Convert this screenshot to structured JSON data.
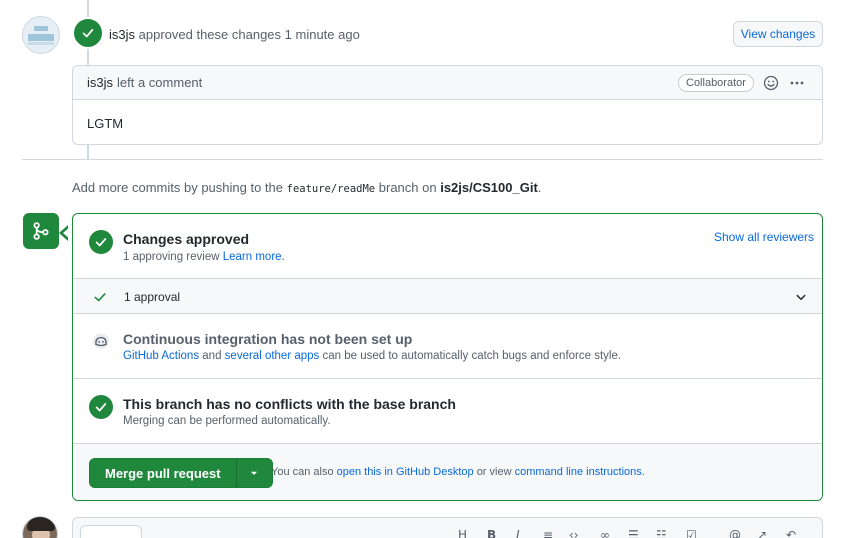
{
  "review": {
    "author": "is3js",
    "action": "approved these changes",
    "time": "1 minute ago",
    "view_changes_label": "View changes"
  },
  "comment": {
    "author": "is3js",
    "action": "left a comment",
    "badge": "Collaborator",
    "body": "LGTM"
  },
  "add_commits": {
    "prefix": "Add more commits by pushing to the",
    "branch": "feature/readMe",
    "middle": "branch on",
    "repo": "is2js/CS100_Git",
    "suffix": "."
  },
  "merge": {
    "approved_title": "Changes approved",
    "approved_sub_prefix": "1 approving review",
    "learn_more": "Learn more.",
    "show_all_reviewers": "Show all reviewers",
    "approvals_label": "1 approval",
    "ci_title": "Continuous integration has not been set up",
    "ci_link1": "GitHub Actions",
    "ci_and": "and",
    "ci_link2": "several other apps",
    "ci_rest": "can be used to automatically catch bugs and enforce style.",
    "conflict_title": "This branch has no conflicts with the base branch",
    "conflict_sub": "Merging can be performed automatically.",
    "merge_button": "Merge pull request",
    "also_prefix": "You can also",
    "desktop_link": "open this in GitHub Desktop",
    "or_view": "or view",
    "cli_link": "command line instructions",
    "period": "."
  },
  "colors": {
    "success": "#1f883d",
    "link": "#0969da",
    "border": "#d0d7de",
    "muted": "#57606a"
  }
}
